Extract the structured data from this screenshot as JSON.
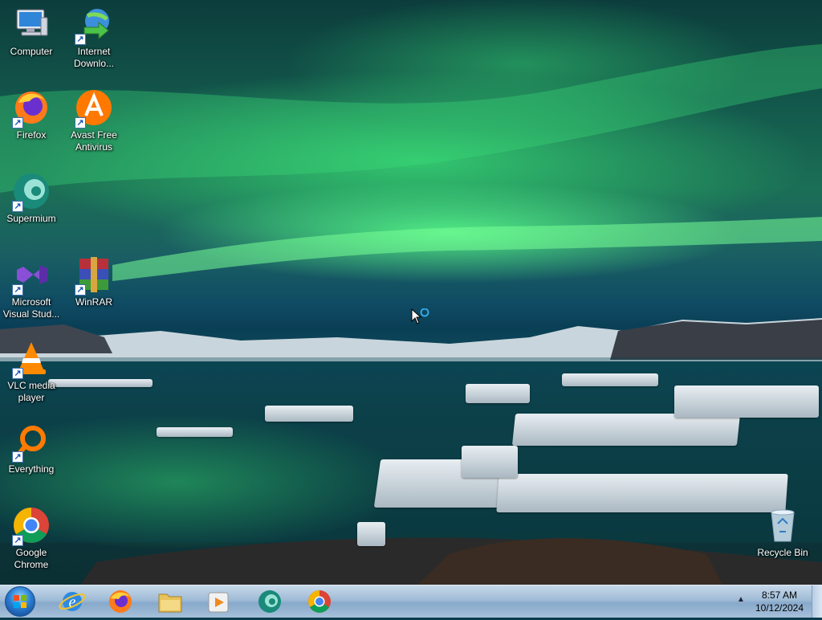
{
  "desktop": {
    "icons": [
      {
        "label": "Computer",
        "icon": "computer-icon",
        "shortcut": false
      },
      {
        "label": "Internet Downlo...",
        "icon": "internet-download-manager-icon",
        "shortcut": true
      },
      {
        "label": "Firefox",
        "icon": "firefox-icon",
        "shortcut": true
      },
      {
        "label": "Avast Free Antivirus",
        "icon": "avast-icon",
        "shortcut": true
      },
      {
        "label": "Supermium",
        "icon": "supermium-icon",
        "shortcut": true
      },
      {
        "label": "Microsoft Visual Stud...",
        "icon": "visual-studio-icon",
        "shortcut": true
      },
      {
        "label": "WinRAR",
        "icon": "winrar-icon",
        "shortcut": true
      },
      {
        "label": "VLC media player",
        "icon": "vlc-icon",
        "shortcut": true
      },
      {
        "label": "Everything",
        "icon": "everything-icon",
        "shortcut": true
      },
      {
        "label": "Google Chrome",
        "icon": "chrome-icon",
        "shortcut": true
      },
      {
        "label": "Recycle Bin",
        "icon": "recycle-bin-icon",
        "shortcut": false
      }
    ]
  },
  "taskbar": {
    "pinned": [
      {
        "icon": "internet-explorer-icon"
      },
      {
        "icon": "firefox-icon"
      },
      {
        "icon": "file-explorer-icon"
      },
      {
        "icon": "media-player-icon"
      },
      {
        "icon": "supermium-icon"
      },
      {
        "icon": "chrome-icon"
      }
    ],
    "tray": {
      "time": "8:57 AM",
      "date": "10/12/2024"
    }
  },
  "colors": {
    "aurora": "#3fe27a",
    "taskbar": "#9fbbd6"
  }
}
